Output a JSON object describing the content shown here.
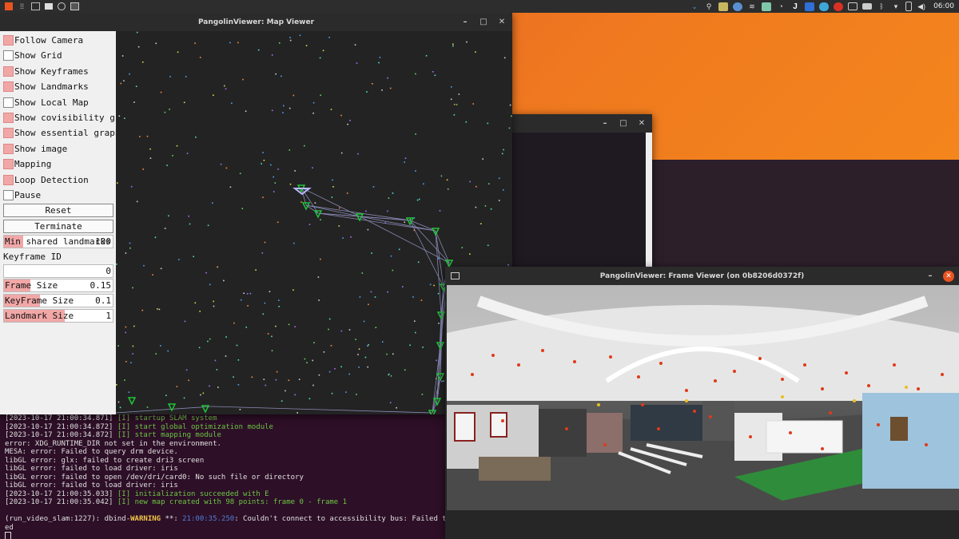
{
  "topbar": {
    "clock": "06:00",
    "tray_icons": [
      "chevron-down-icon",
      "search-icon",
      "lock-icon",
      "app-icon",
      "wifi-icon",
      "app-icon",
      "notification-icon",
      "j-app-icon",
      "shield-icon",
      "cloud-icon",
      "gmail-icon",
      "mail-icon",
      "battery-icon",
      "bluetooth-icon",
      "wifi-icon",
      "battery-icon",
      "volume-icon"
    ]
  },
  "map_viewer": {
    "title": "PangolinViewer: Map Viewer",
    "checkboxes": [
      {
        "label": "Follow Camera",
        "checked": true
      },
      {
        "label": "Show Grid",
        "checked": false
      },
      {
        "label": "Show Keyframes",
        "checked": true
      },
      {
        "label": "Show Landmarks",
        "checked": true
      },
      {
        "label": "Show Local Map",
        "checked": false
      },
      {
        "label": "Show covisibility graph",
        "checked": true
      },
      {
        "label": "Show essential graph",
        "checked": true
      },
      {
        "label": "Show image",
        "checked": true
      },
      {
        "label": "Mapping",
        "checked": true
      },
      {
        "label": "Loop Detection",
        "checked": true
      },
      {
        "label": "Pause",
        "checked": false
      }
    ],
    "buttons": [
      "Reset",
      "Terminate"
    ],
    "min_shared": {
      "label": "Min shared landmarks",
      "value": "100",
      "fraction": 0.18
    },
    "keyframe_id": {
      "label": "Keyframe ID",
      "value": "0"
    },
    "frame_size": {
      "label": "Frame Size",
      "value": "0.15",
      "fraction": 0.24
    },
    "keyframe_size": {
      "label": "KeyFrame Size",
      "value": "0.1",
      "fraction": 0.33
    },
    "landmark_size": {
      "label": "Landmark Size",
      "value": "1",
      "fraction": 0.56
    }
  },
  "frame_viewer": {
    "title": "PangolinViewer: Frame Viewer (on 0b8206d0372f)"
  },
  "terminal": {
    "lines": [
      {
        "ts": "[2023-10-17 21:00:34.871]",
        "tag": " [I] ",
        "msg": "startup SLAM system"
      },
      {
        "ts": "[2023-10-17 21:00:34.872]",
        "tag": " [I] ",
        "msg": "start global optimization module"
      },
      {
        "ts": "[2023-10-17 21:00:34.872]",
        "tag": " [I] ",
        "msg": "start mapping module"
      },
      {
        "plain": "error: XDG_RUNTIME_DIR not set in the environment."
      },
      {
        "plain": "MESA: error: Failed to query drm device."
      },
      {
        "plain": "libGL error: glx: failed to create dri3 screen"
      },
      {
        "plain": "libGL error: failed to load driver: iris"
      },
      {
        "plain": "libGL error: failed to open /dev/dri/card0: No such file or directory"
      },
      {
        "plain": "libGL error: failed to load driver: iris"
      },
      {
        "ts": "[2023-10-17 21:00:35.033]",
        "tag": " [I] ",
        "msg": "initialization succeeded with E"
      },
      {
        "ts": "[2023-10-17 21:00:35.042]",
        "tag": " [I] ",
        "msg": "new map created with 98 points: frame 0 - frame 1"
      },
      {
        "plain": ""
      }
    ],
    "warning_prefix": "(run_video_slam:1227): dbind-",
    "warning_word": "WARNING",
    "warning_mid": " **: ",
    "warning_time": "21:00:35.250",
    "warning_msg": ": Couldn't connect to accessibility bus: Failed to connect",
    "warning_tail": "ed"
  },
  "colors": {
    "accent": "#e95420",
    "checkbox_on": "#f2a7a7",
    "terminal_bg": "#2d0f27",
    "keyframe": "#22c33a",
    "camera": "#b7b7ff"
  }
}
